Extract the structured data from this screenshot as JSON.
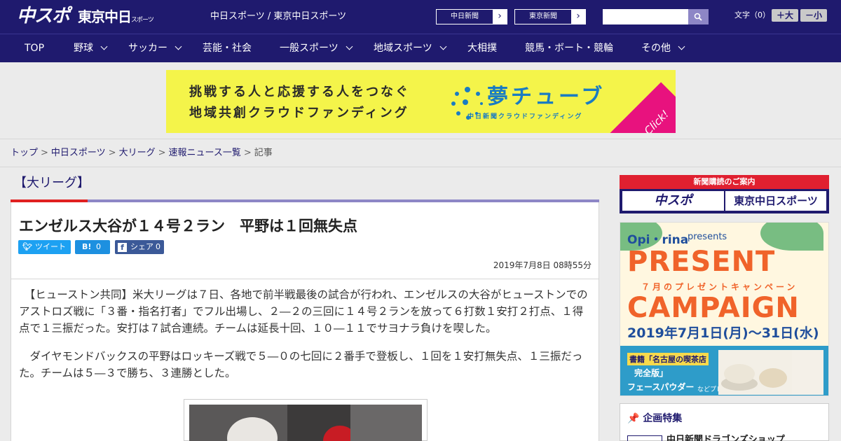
{
  "header": {
    "logo_chuspo": "中スポ",
    "logo_tokyo": "東京中日",
    "logo_tokyo_small": "スポーツ",
    "site_names": "中日スポーツ / 東京中日スポーツ",
    "paper_buttons": [
      {
        "label": "中日新聞",
        "arrow": "›"
      },
      {
        "label": "東京新聞",
        "arrow": "›"
      }
    ],
    "search": {
      "placeholder": "",
      "value": ""
    },
    "font_size_label": "文字（0）",
    "font_increase": "＋大",
    "font_decrease": "－小"
  },
  "nav": {
    "items": [
      {
        "label": "TOP",
        "has_dropdown": false
      },
      {
        "label": "野球",
        "has_dropdown": true
      },
      {
        "label": "サッカー",
        "has_dropdown": true
      },
      {
        "label": "芸能・社会",
        "has_dropdown": false
      },
      {
        "label": "一般スポーツ",
        "has_dropdown": true
      },
      {
        "label": "地域スポーツ",
        "has_dropdown": true
      },
      {
        "label": "大相撲",
        "has_dropdown": false
      },
      {
        "label": "競馬・ボート・競輪",
        "has_dropdown": false
      },
      {
        "label": "その他",
        "has_dropdown": true
      }
    ]
  },
  "banner": {
    "line1": "挑戦する人と応援する人をつなぐ",
    "line2": "地域共創クラウドファンディング",
    "brand": "夢チューブ",
    "brand_sub": "中日新聞クラウドファンディング",
    "click": "Click!"
  },
  "breadcrumb": {
    "items": [
      "トップ",
      "中日スポーツ",
      "大リーグ",
      "速報ニュース一覧"
    ],
    "current": "記事",
    "separator": ">"
  },
  "article": {
    "category": "【大リーグ】",
    "headline": "エンゼルス大谷が１４号２ラン　平野は１回無失点",
    "share": {
      "tweet": "ツイート",
      "hatena_icon": "B!",
      "hatena_count": "0",
      "facebook_label": "シェア",
      "facebook_count": "0"
    },
    "date": "2019年7月8日 08時55分",
    "paragraphs": [
      "【ヒューストン共同】米大リーグは７日、各地で前半戦最後の試合が行われ、エンゼルスの大谷がヒューストンでのアストロズ戦に「３番・指名打者」でフル出場し、２―２の三回に１４号２ランを放って６打数１安打２打点、１得点で１三振だった。安打は７試合連続。チームは延長十回、１０―１１でサヨナラ負けを喫した。",
      "ダイヤモンドバックスの平野はロッキーズ戦で５―０の七回に２番手で登板し、１回を１安打無失点、１三振だった。チームは５―３で勝ち、３連勝とした。"
    ]
  },
  "sidebar": {
    "subscribe_head": "新聞購読のご案内",
    "subscribe_chuspo": "中スポ",
    "subscribe_tokyo": "東京中日スポーツ",
    "campaign": {
      "brand": "Opi・rina",
      "presents": "presents",
      "present": "PRESENT",
      "jp": "７月のプレゼントキャンペーン",
      "campaign": "CAMPAIGN",
      "dates": "2019年7月1日(月)〜31日(水)",
      "book": "書籍「名古屋の喫茶店",
      "book2": "完全版」",
      "powder": "フェースパウダー",
      "nado": "などプレゼント"
    },
    "kikaku_title": "企画特集",
    "kikaku_item": "中日新聞ドラゴンズショップ"
  },
  "colors": {
    "header_bg": "#1f1a6e",
    "accent_red": "#e02020",
    "accent_lilac": "#8d86c6",
    "banner_yellow": "#f4f44a"
  }
}
